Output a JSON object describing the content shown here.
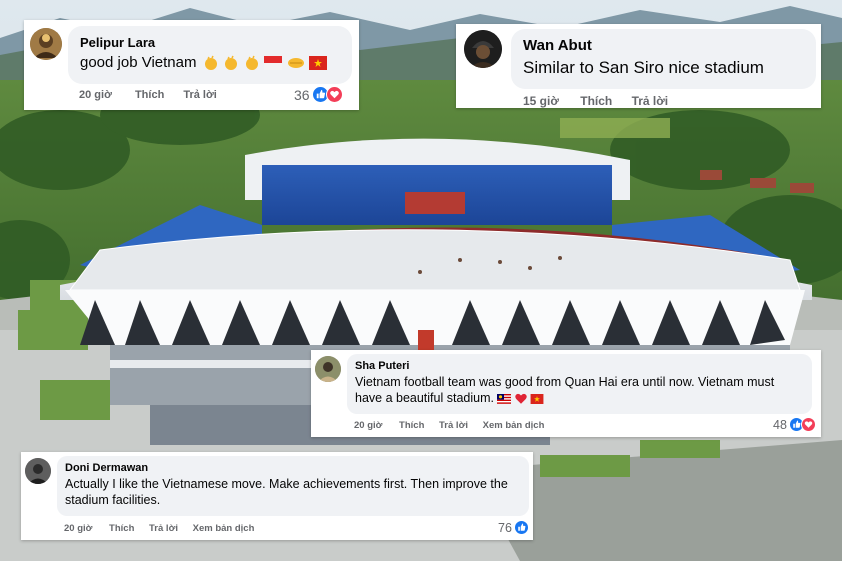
{
  "comments": [
    {
      "author": "Pelipur Lara",
      "text": "good job Vietnam",
      "emojis": [
        "clapping-hands",
        "clapping-hands",
        "clapping-hands",
        "indonesia-flag",
        "handshake",
        "vietnam-flag"
      ],
      "time": "20 giờ",
      "like_label": "Thích",
      "reply_label": "Trả lời",
      "reaction_count": "36",
      "reactions": [
        "like",
        "love"
      ]
    },
    {
      "author": "Wan Abut",
      "text": "Similar to San Siro nice stadium",
      "time": "15 giờ",
      "like_label": "Thích",
      "reply_label": "Trả lời"
    },
    {
      "author": "Sha Puteri",
      "text": "Vietnam football team was good from Quan Hai era until now. Vietnam must have a beautiful stadium.",
      "emojis": [
        "malaysia-flag",
        "red-heart",
        "vietnam-flag"
      ],
      "time": "20 giờ",
      "like_label": "Thích",
      "reply_label": "Trả lời",
      "translate_label": "Xem bản dịch",
      "reaction_count": "48",
      "reactions": [
        "like",
        "love"
      ]
    },
    {
      "author": "Doni Dermawan",
      "text": "Actually I like the Vietnamese move. Make achievements first. Then improve the stadium facilities.",
      "time": "20 giờ",
      "like_label": "Thích",
      "reply_label": "Trả lời",
      "translate_label": "Xem bản dịch",
      "reaction_count": "76",
      "reactions": [
        "like"
      ]
    }
  ],
  "colors": {
    "like": "#1877f2",
    "love": "#f33e58",
    "bubble": "#f0f2f5",
    "meta": "#65676b",
    "text": "#050505"
  }
}
